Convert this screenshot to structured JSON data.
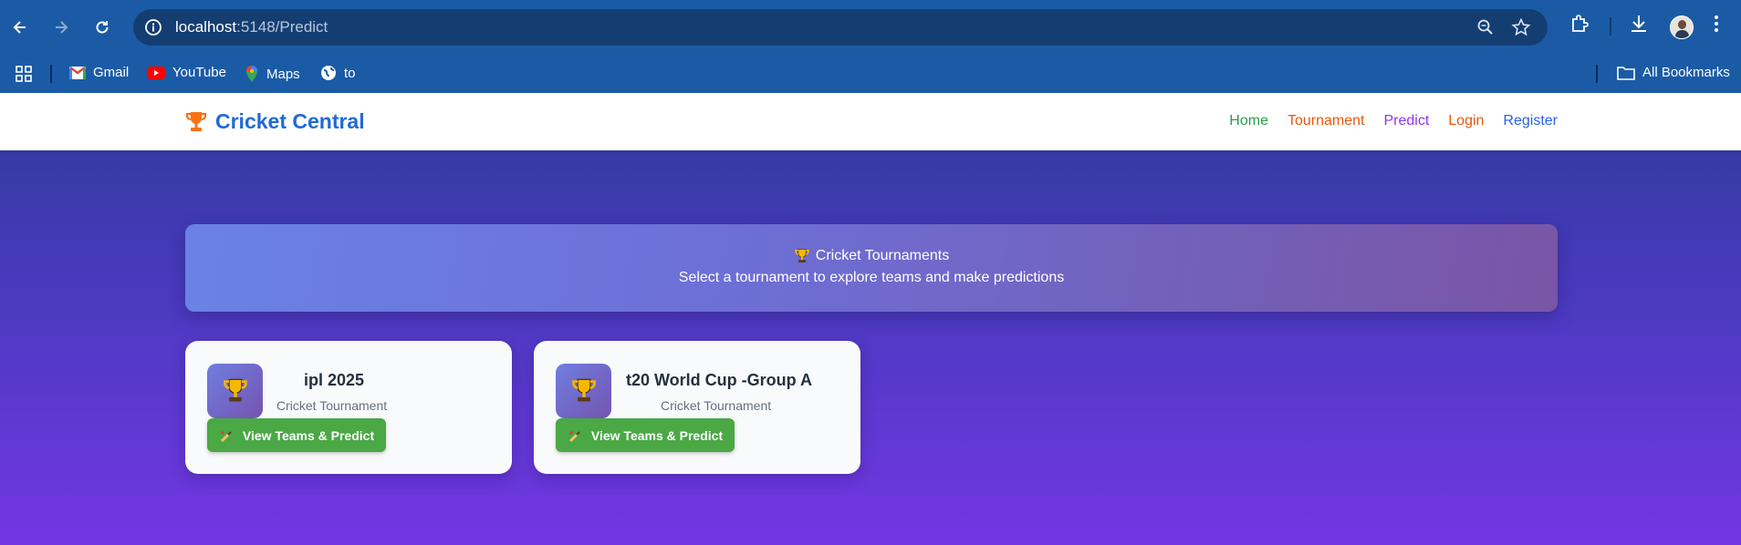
{
  "browser": {
    "url_host": "localhost",
    "url_path": ":5148/Predict",
    "bookmarks": [
      {
        "label": "Gmail",
        "icon": "gmail-icon"
      },
      {
        "label": "YouTube",
        "icon": "youtube-icon"
      },
      {
        "label": "Maps",
        "icon": "maps-icon"
      },
      {
        "label": "to",
        "icon": "globe-icon"
      }
    ],
    "all_bookmarks": "All Bookmarks"
  },
  "site": {
    "brand": "Cricket Central",
    "nav": [
      {
        "label": "Home",
        "color": "#2a9d4b"
      },
      {
        "label": "Tournament",
        "color": "#e8590c"
      },
      {
        "label": "Predict",
        "color": "#9333ea"
      },
      {
        "label": "Login",
        "color": "#e8590c"
      },
      {
        "label": "Register",
        "color": "#2563eb"
      }
    ]
  },
  "hero": {
    "title": "Cricket Tournaments",
    "subtitle": "Select a tournament to explore teams and make predictions"
  },
  "tournaments": [
    {
      "name": "ipl 2025",
      "type": "Cricket Tournament",
      "button": "View Teams & Predict"
    },
    {
      "name": "t20 World Cup -Group A",
      "type": "Cricket Tournament",
      "button": "View Teams & Predict"
    }
  ],
  "colors": {
    "brand": "#1f6ad8",
    "button": "#4aa845",
    "chrome": "#1b5ba6"
  }
}
